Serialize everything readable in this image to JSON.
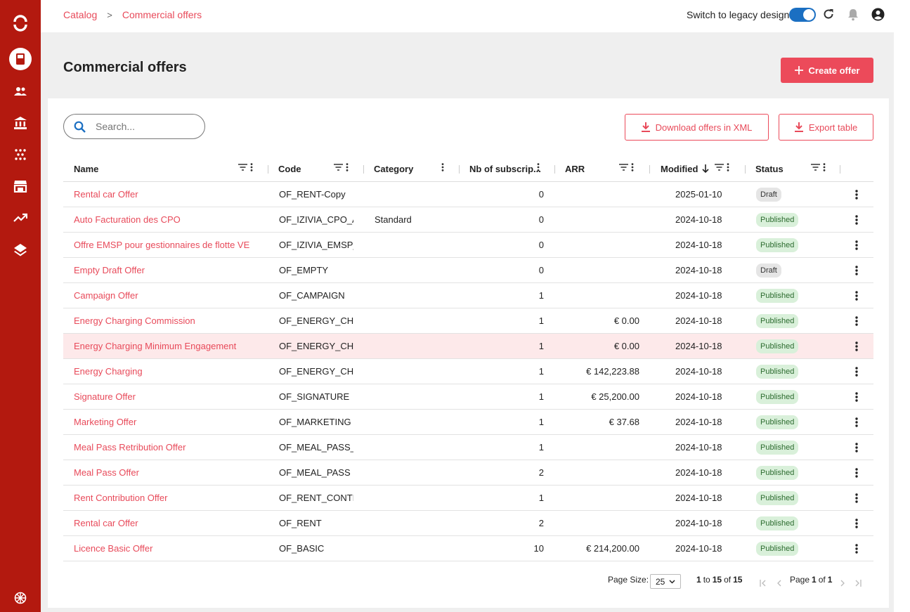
{
  "breadcrumb": {
    "root": "Catalog",
    "separator": ">",
    "current": "Commercial offers"
  },
  "topbar": {
    "legacy_label": "Switch to legacy design",
    "legacy_toggle_on": true
  },
  "page": {
    "title": "Commercial offers",
    "create_label": "Create offer"
  },
  "toolbar": {
    "search_placeholder": "Search...",
    "download_label": "Download offers in XML",
    "export_label": "Export table"
  },
  "columns": {
    "name": "Name",
    "code": "Code",
    "category": "Category",
    "nb": "Nb of subscrip...",
    "arr": "ARR",
    "modified": "Modified",
    "status": "Status"
  },
  "rows": [
    {
      "name": "Rental car Offer",
      "code": "OF_RENT-Copy",
      "category": "",
      "nb": "0",
      "arr": "",
      "modified": "2025-01-10",
      "status": "Draft"
    },
    {
      "name": "Auto Facturation des CPO",
      "code": "OF_IZIVIA_CPO_AU",
      "category": "Standard",
      "nb": "0",
      "arr": "",
      "modified": "2024-10-18",
      "status": "Published"
    },
    {
      "name": "Offre EMSP pour gestionnaires de flotte VE",
      "code": "OF_IZIVIA_EMSP_F",
      "category": "",
      "nb": "0",
      "arr": "",
      "modified": "2024-10-18",
      "status": "Published"
    },
    {
      "name": "Empty Draft Offer",
      "code": "OF_EMPTY",
      "category": "",
      "nb": "0",
      "arr": "",
      "modified": "2024-10-18",
      "status": "Draft"
    },
    {
      "name": "Campaign Offer",
      "code": "OF_CAMPAIGN",
      "category": "",
      "nb": "1",
      "arr": "",
      "modified": "2024-10-18",
      "status": "Published"
    },
    {
      "name": "Energy Charging Commission",
      "code": "OF_ENERGY_CHAF",
      "category": "",
      "nb": "1",
      "arr": "€ 0.00",
      "modified": "2024-10-18",
      "status": "Published"
    },
    {
      "name": "Energy Charging Minimum Engagement",
      "code": "OF_ENERGY_CHAF",
      "category": "",
      "nb": "1",
      "arr": "€ 0.00",
      "modified": "2024-10-18",
      "status": "Published",
      "highlight": true
    },
    {
      "name": "Energy Charging",
      "code": "OF_ENERGY_CHAF",
      "category": "",
      "nb": "1",
      "arr": "€ 142,223.88",
      "modified": "2024-10-18",
      "status": "Published"
    },
    {
      "name": "Signature Offer",
      "code": "OF_SIGNATURE",
      "category": "",
      "nb": "1",
      "arr": "€ 25,200.00",
      "modified": "2024-10-18",
      "status": "Published"
    },
    {
      "name": "Marketing Offer",
      "code": "OF_MARKETING",
      "category": "",
      "nb": "1",
      "arr": "€ 37.68",
      "modified": "2024-10-18",
      "status": "Published"
    },
    {
      "name": "Meal Pass Retribution Offer",
      "code": "OF_MEAL_PASS_R",
      "category": "",
      "nb": "1",
      "arr": "",
      "modified": "2024-10-18",
      "status": "Published"
    },
    {
      "name": "Meal Pass Offer",
      "code": "OF_MEAL_PASS",
      "category": "",
      "nb": "2",
      "arr": "",
      "modified": "2024-10-18",
      "status": "Published"
    },
    {
      "name": "Rent Contribution Offer",
      "code": "OF_RENT_CONTRII",
      "category": "",
      "nb": "1",
      "arr": "",
      "modified": "2024-10-18",
      "status": "Published"
    },
    {
      "name": "Rental car Offer",
      "code": "OF_RENT",
      "category": "",
      "nb": "2",
      "arr": "",
      "modified": "2024-10-18",
      "status": "Published"
    },
    {
      "name": "Licence Basic Offer",
      "code": "OF_BASIC",
      "category": "",
      "nb": "10",
      "arr": "€ 214,200.00",
      "modified": "2024-10-18",
      "status": "Published"
    }
  ],
  "pagination": {
    "page_size_label": "Page Size:",
    "page_size": "25",
    "range_from": "1",
    "range_to": "15",
    "range_total": "15",
    "to_word": "to",
    "of_word": "of",
    "page_word": "Page",
    "page_current": "1",
    "page_total": "1"
  },
  "colors": {
    "brand": "#b3190f",
    "accent": "#ec4a5a",
    "toggle": "#1b6fc2"
  },
  "icons": [
    "logo-icon",
    "catalog-icon",
    "customers-icon",
    "bank-icon",
    "integrations-icon",
    "store-icon",
    "analytics-icon",
    "layers-icon",
    "language-icon",
    "refresh-icon",
    "bell-icon",
    "account-icon",
    "search-icon",
    "plus-icon",
    "download-icon",
    "filter-icon",
    "kebab-icon",
    "sort-desc-icon"
  ]
}
